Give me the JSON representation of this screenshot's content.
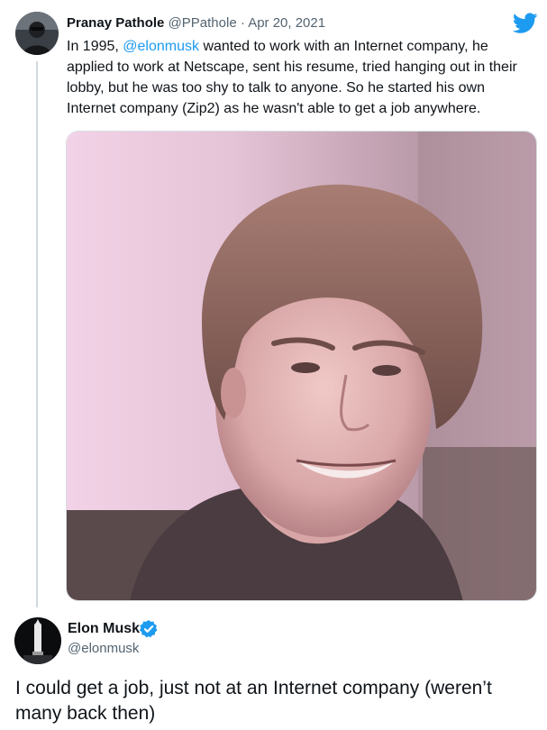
{
  "parent_tweet": {
    "author_name": "Pranay Pathole",
    "handle": "@PPathole",
    "separator": " · ",
    "date": "Apr 20, 2021",
    "text_before_mention": "In 1995, ",
    "mention": "@elonmusk",
    "text_after_mention": " wanted to work with an Internet company, he applied to work at Netscape, sent his resume, tried hanging out in their lobby, but he was too shy to talk to anyone. So he started his own Internet company (Zip2) as he wasn't able to get a job anywhere.",
    "photo_icon": "young-man-photo"
  },
  "reply_tweet": {
    "author_name": "Elon Musk",
    "verified_icon": "verified-badge-icon",
    "handle": "@elonmusk",
    "text": "I could get a job, just not at an Internet company (weren’t many back then)"
  },
  "brand": {
    "icon": "twitter-bird-icon",
    "color": "#1d9bf0"
  },
  "colors": {
    "link": "#1d9bf0",
    "secondary_text": "#536471",
    "primary_text": "#0f1419"
  }
}
